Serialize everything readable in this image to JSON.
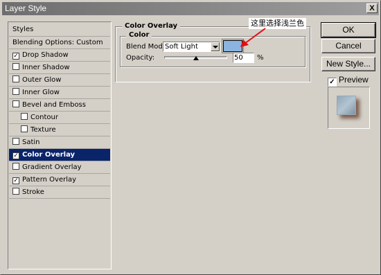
{
  "window": {
    "title": "Layer Style",
    "close_label": "X"
  },
  "styles_list": {
    "header": "Styles",
    "items": [
      {
        "label": "Blending Options: Custom",
        "checkbox": false,
        "checked": false,
        "indent": false,
        "selected": false
      },
      {
        "label": "Drop Shadow",
        "checkbox": true,
        "checked": true,
        "indent": false,
        "selected": false
      },
      {
        "label": "Inner Shadow",
        "checkbox": true,
        "checked": false,
        "indent": false,
        "selected": false
      },
      {
        "label": "Outer Glow",
        "checkbox": true,
        "checked": false,
        "indent": false,
        "selected": false
      },
      {
        "label": "Inner Glow",
        "checkbox": true,
        "checked": false,
        "indent": false,
        "selected": false
      },
      {
        "label": "Bevel and Emboss",
        "checkbox": true,
        "checked": false,
        "indent": false,
        "selected": false
      },
      {
        "label": "Contour",
        "checkbox": true,
        "checked": false,
        "indent": true,
        "selected": false
      },
      {
        "label": "Texture",
        "checkbox": true,
        "checked": false,
        "indent": true,
        "selected": false
      },
      {
        "label": "Satin",
        "checkbox": true,
        "checked": false,
        "indent": false,
        "selected": false
      },
      {
        "label": "Color Overlay",
        "checkbox": true,
        "checked": true,
        "indent": false,
        "selected": true
      },
      {
        "label": "Gradient Overlay",
        "checkbox": true,
        "checked": false,
        "indent": false,
        "selected": false
      },
      {
        "label": "Pattern Overlay",
        "checkbox": true,
        "checked": true,
        "indent": false,
        "selected": false
      },
      {
        "label": "Stroke",
        "checkbox": true,
        "checked": false,
        "indent": false,
        "selected": false
      }
    ]
  },
  "color_overlay": {
    "section_title": "Color Overlay",
    "group_title": "Color",
    "blend_mode_label": "Blend Mode:",
    "blend_mode_value": "Soft Light",
    "overlay_color": "#8cb4e0",
    "opacity_label": "Opacity:",
    "opacity_value": "50",
    "opacity_unit": "%",
    "opacity_percent": 50
  },
  "annotation": {
    "text": "这里选择浅兰色",
    "arrow_color": "#e01010"
  },
  "buttons": {
    "ok": "OK",
    "cancel": "Cancel",
    "new_style": "New Style...",
    "preview_label": "Preview",
    "preview_checked": true
  },
  "colors": {
    "selection": "#0a246a",
    "dialog_bg": "#d4d0c8"
  }
}
